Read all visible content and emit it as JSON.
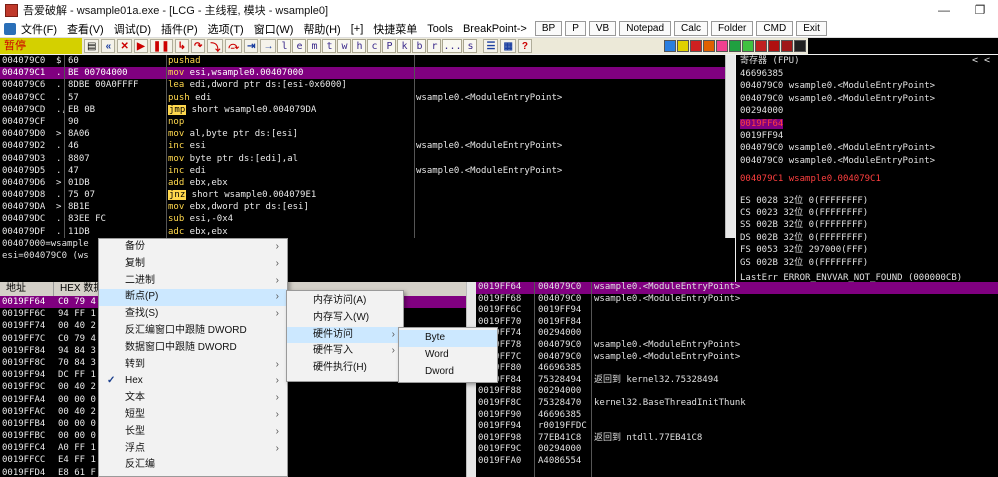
{
  "title": "吾爱破解 - wsample01a.exe - [LCG - 主线程, 模块 - wsample0]",
  "window": {
    "minimize": "—",
    "restore": "❐"
  },
  "menubar": {
    "items": [
      "文件(F)",
      "查看(V)",
      "调试(D)",
      "插件(P)",
      "选项(T)",
      "窗口(W)",
      "帮助(H)",
      "[+]",
      "快捷菜单",
      "Tools",
      "BreakPoint->"
    ],
    "buttons": [
      "BP",
      "P",
      "VB",
      "Notepad",
      "Calc",
      "Folder",
      "CMD",
      "Exit"
    ]
  },
  "toolbar": {
    "status": "暂停",
    "letters": [
      "l",
      "e",
      "m",
      "t",
      "w",
      "h",
      "c",
      "P",
      "k",
      "b",
      "r",
      "...",
      "s"
    ]
  },
  "disasm": [
    {
      "addr": "004079C0",
      "arrow": "$",
      "hex": "60",
      "ins": "pushad",
      "cmt": "",
      "sel": false
    },
    {
      "addr": "004079C1",
      "arrow": ".",
      "hex": "BE 00704000",
      "ins": "mov esi,wsample0.00407000",
      "cmt": "",
      "sel": true
    },
    {
      "addr": "004079C6",
      "arrow": ".",
      "hex": "8DBE 00A0FFFF",
      "ins": "lea edi,dword ptr ds:[esi-0x6000]",
      "cmt": "",
      "sel": false
    },
    {
      "addr": "004079CC",
      "arrow": ".",
      "hex": "57",
      "ins": "push edi",
      "cmt": "wsample0.<ModuleEntryPoint>",
      "sel": false
    },
    {
      "addr": "004079CD",
      "arrow": ".,",
      "hex": "EB 0B",
      "ins": "jmp short wsample0.004079DA",
      "cmt": "",
      "sel": false
    },
    {
      "addr": "004079CF",
      "arrow": "",
      "hex": "90",
      "ins": "nop",
      "cmt": "",
      "sel": false
    },
    {
      "addr": "004079D0",
      "arrow": ">",
      "hex": "8A06",
      "ins": "mov al,byte ptr ds:[esi]",
      "cmt": "",
      "sel": false
    },
    {
      "addr": "004079D2",
      "arrow": ".",
      "hex": "46",
      "ins": "inc esi",
      "cmt": "wsample0.<ModuleEntryPoint>",
      "sel": false
    },
    {
      "addr": "004079D3",
      "arrow": ".",
      "hex": "8807",
      "ins": "mov byte ptr ds:[edi],al",
      "cmt": "",
      "sel": false
    },
    {
      "addr": "004079D5",
      "arrow": ".",
      "hex": "47",
      "ins": "inc edi",
      "cmt": "wsample0.<ModuleEntryPoint>",
      "sel": false
    },
    {
      "addr": "004079D6",
      "arrow": ">",
      "hex": "01DB",
      "ins": "add ebx,ebx",
      "cmt": "",
      "sel": false
    },
    {
      "addr": "004079D8",
      "arrow": ".",
      "hex": "75 07",
      "ins": "jnz short wsample0.004079E1",
      "cmt": "",
      "sel": false
    },
    {
      "addr": "004079DA",
      "arrow": ">",
      "hex": "8B1E",
      "ins": "mov ebx,dword ptr ds:[esi]",
      "cmt": "",
      "sel": false
    },
    {
      "addr": "004079DC",
      "arrow": ".",
      "hex": "83EE FC",
      "ins": "sub esi,-0x4",
      "cmt": "",
      "sel": false
    },
    {
      "addr": "004079DF",
      "arrow": ".",
      "hex": "11DB",
      "ins": "adc ebx,ebx",
      "cmt": "",
      "sel": false
    }
  ],
  "info": [
    "00407000=wsample",
    "esi=004079C0 (ws"
  ],
  "registers": {
    "title": "寄存器 (FPU)",
    "arrows": "<   <",
    "rows": [
      {
        "text": "46696385",
        "style": ""
      },
      {
        "text": "004079C0 wsample0.<ModuleEntryPoint>",
        "style": ""
      },
      {
        "text": "004079C0 wsample0.<ModuleEntryPoint>",
        "style": ""
      },
      {
        "text": "00294000",
        "style": ""
      },
      {
        "text": "0019FF64",
        "style": "hlbg"
      },
      {
        "text": "0019FF94",
        "style": ""
      },
      {
        "text": "004079C0 wsample0.<ModuleEntryPoint>",
        "style": ""
      },
      {
        "text": "004079C0 wsample0.<ModuleEntryPoint>",
        "style": ""
      },
      {
        "text": "004079C1 wsample0.004079C1",
        "style": "hl"
      },
      {
        "text": "ES 0028 32位 0(FFFFFFFF)",
        "style": ""
      },
      {
        "text": "CS 0023 32位 0(FFFFFFFF)",
        "style": ""
      },
      {
        "text": "SS 002B 32位 0(FFFFFFFF)",
        "style": ""
      },
      {
        "text": "DS 002B 32位 0(FFFFFFFF)",
        "style": ""
      },
      {
        "text": "FS 0053 32位 297000(FFF)",
        "style": ""
      },
      {
        "text": "GS 002B 32位 0(FFFFFFFF)",
        "style": ""
      },
      {
        "text": "LastErr ERROR_ENVVAR_NOT_FOUND (000000CB)",
        "style": ""
      }
    ]
  },
  "dump": {
    "headers": [
      "地址",
      "HEX 数据"
    ],
    "rows": [
      {
        "addr": "0019FF64",
        "hex": "C0 79 4",
        "sel": true
      },
      {
        "addr": "0019FF6C",
        "hex": "94 FF 1",
        "sel": false
      },
      {
        "addr": "0019FF74",
        "hex": "00 40 2",
        "sel": false
      },
      {
        "addr": "0019FF7C",
        "hex": "C0 79 4",
        "sel": false
      },
      {
        "addr": "0019FF84",
        "hex": "94 84 3",
        "sel": false
      },
      {
        "addr": "0019FF8C",
        "hex": "70 84 3",
        "sel": false
      },
      {
        "addr": "0019FF94",
        "hex": "DC FF 1",
        "sel": false
      },
      {
        "addr": "0019FF9C",
        "hex": "00 40 2",
        "sel": false
      },
      {
        "addr": "0019FFA4",
        "hex": "00 00 0",
        "sel": false
      },
      {
        "addr": "0019FFAC",
        "hex": "00 40 2",
        "sel": false
      },
      {
        "addr": "0019FFB4",
        "hex": "00 00 0",
        "sel": false
      },
      {
        "addr": "0019FFBC",
        "hex": "00 00 0",
        "sel": false
      },
      {
        "addr": "0019FFC4",
        "hex": "A0 FF 1",
        "sel": false
      },
      {
        "addr": "0019FFCC",
        "hex": "E4 FF 1",
        "sel": false
      },
      {
        "addr": "0019FFD4",
        "hex": "E8 61 F",
        "sel": false
      }
    ]
  },
  "stack": [
    {
      "addr": "0019FF64",
      "val": "004079C0",
      "cmt": "wsample0.<ModuleEntryPoint>",
      "sel": true
    },
    {
      "addr": "0019FF68",
      "val": "004079C0",
      "cmt": "wsample0.<ModuleEntryPoint>",
      "sel": false
    },
    {
      "addr": "0019FF6C",
      "val": "0019FF94",
      "cmt": "",
      "sel": false
    },
    {
      "addr": "0019FF70",
      "val": "0019FF84",
      "cmt": "",
      "sel": false
    },
    {
      "addr": "0019FF74",
      "val": "00294000",
      "cmt": "",
      "sel": false
    },
    {
      "addr": "0019FF78",
      "val": "004079C0",
      "cmt": "wsample0.<ModuleEntryPoint>",
      "sel": false
    },
    {
      "addr": "0019FF7C",
      "val": "004079C0",
      "cmt": "wsample0.<ModuleEntryPoint>",
      "sel": false
    },
    {
      "addr": "0019FF80",
      "val": "46696385",
      "cmt": "",
      "sel": false
    },
    {
      "addr": "0019FF84",
      "val": "75328494",
      "cmt": "返回到 kernel32.75328494",
      "sel": false
    },
    {
      "addr": "0019FF88",
      "val": "00294000",
      "cmt": "",
      "sel": false
    },
    {
      "addr": "0019FF8C",
      "val": "75328470",
      "cmt": "kernel32.BaseThreadInitThunk",
      "sel": false
    },
    {
      "addr": "0019FF90",
      "val": "46696385",
      "cmt": "",
      "sel": false
    },
    {
      "addr": "0019FF94",
      "val": "r0019FFDC",
      "cmt": "",
      "sel": false
    },
    {
      "addr": "0019FF98",
      "val": "77EB41C8",
      "cmt": "返回到 ntdll.77EB41C8",
      "sel": false
    },
    {
      "addr": "0019FF9C",
      "val": "00294000",
      "cmt": "",
      "sel": false
    },
    {
      "addr": "0019FFA0",
      "val": "A4086554",
      "cmt": "",
      "sel": false
    }
  ],
  "context_menu": {
    "main": [
      {
        "label": "备份",
        "arrow": "›",
        "hl": false
      },
      {
        "label": "复制",
        "arrow": "›",
        "hl": false
      },
      {
        "label": "二进制",
        "arrow": "›",
        "hl": false
      },
      {
        "label": "断点(P)",
        "arrow": "›",
        "hl": true
      },
      {
        "label": "查找(S)",
        "arrow": "›",
        "hl": false
      },
      {
        "label": "反汇编窗口中跟随 DWORD",
        "arrow": "",
        "hl": false
      },
      {
        "label": "数据窗口中跟随 DWORD",
        "arrow": "",
        "hl": false
      },
      {
        "label": "转到",
        "arrow": "›",
        "hl": false
      },
      {
        "label": "Hex",
        "arrow": "›",
        "hl": false,
        "check": "✓"
      },
      {
        "label": "文本",
        "arrow": "›",
        "hl": false
      },
      {
        "label": "短型",
        "arrow": "›",
        "hl": false
      },
      {
        "label": "长型",
        "arrow": "›",
        "hl": false
      },
      {
        "label": "浮点",
        "arrow": "›",
        "hl": false
      },
      {
        "label": "反汇编",
        "arrow": "",
        "hl": false
      }
    ],
    "breakpoint": [
      {
        "label": "内存访问(A)",
        "arrow": "",
        "hl": false
      },
      {
        "label": "内存写入(W)",
        "arrow": "",
        "hl": false
      },
      {
        "label": "硬件访问",
        "arrow": "›",
        "hl": true
      },
      {
        "label": "硬件写入",
        "arrow": "›",
        "hl": false
      },
      {
        "label": "硬件执行(H)",
        "arrow": "",
        "hl": false
      }
    ],
    "hardware": [
      {
        "label": "Byte",
        "hl": true
      },
      {
        "label": "Word",
        "hl": false
      },
      {
        "label": "Dword",
        "hl": false
      }
    ]
  }
}
